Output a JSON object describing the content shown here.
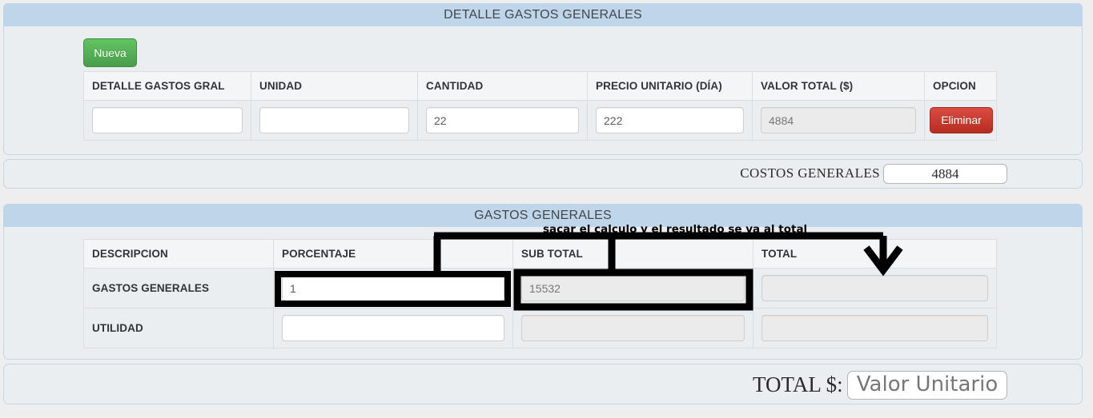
{
  "sections": {
    "detalle_title": "DETALLE GASTOS GENERALES",
    "gastos_title": "GASTOS GENERALES"
  },
  "toolbar": {
    "nueva_label": "Nueva"
  },
  "detalle_table": {
    "headers": [
      "DETALLE GASTOS GRAL",
      "UNIDAD",
      "CANTIDAD",
      "PRECIO UNITARIO (DÍA)",
      "VALOR TOTAL ($)",
      "OPCION"
    ],
    "row": {
      "detalle_value": "",
      "unidad_value": "",
      "cantidad_value": "22",
      "precio_value": "222",
      "valor_total_value": "4884",
      "eliminar_label": "Eliminar"
    }
  },
  "costos_generales": {
    "label": "COSTOS GENERALES",
    "value": "4884"
  },
  "gastos_table": {
    "headers": [
      "DESCRIPCION",
      "PORCENTAJE",
      "SUB TOTAL",
      "TOTAL"
    ],
    "rows": [
      {
        "descripcion": "GASTOS GENERALES",
        "porcentaje": "1",
        "sub_total": "15532",
        "total": ""
      },
      {
        "descripcion": "UTILIDAD",
        "porcentaje": "",
        "sub_total": "",
        "total": ""
      }
    ]
  },
  "total_row": {
    "label": "TOTAL $:",
    "placeholder": "Valor Unitario",
    "value": ""
  },
  "annotation": {
    "note": "sacar el calculo y el resultado se va al total",
    "ink_color": "#000000"
  },
  "colors": {
    "section_bar": "#bed5ea",
    "panel_bg": "#eaeef1",
    "page_bg": "#eeeeee",
    "nueva_green": "#4a9d4a",
    "eliminar_red": "#b72d22"
  }
}
